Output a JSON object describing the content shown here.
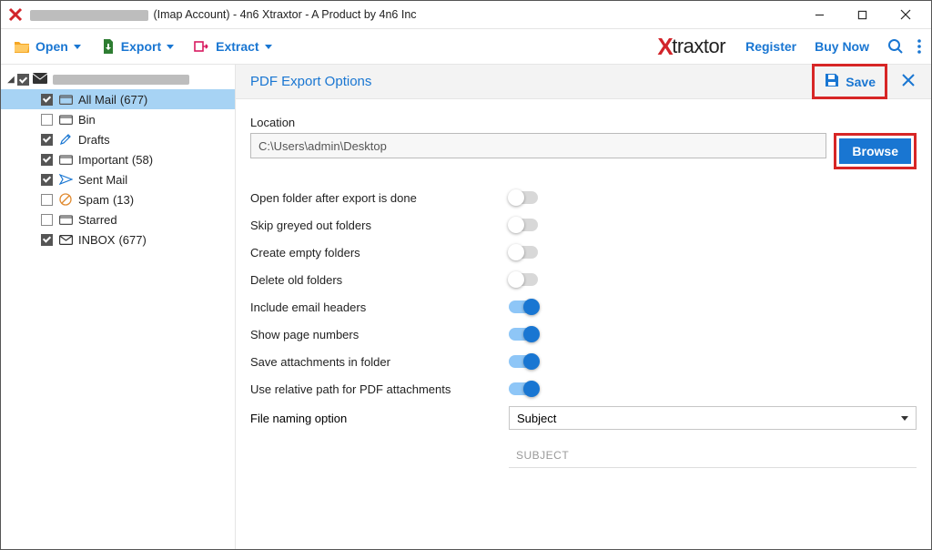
{
  "titlebar": {
    "suffix": "(Imap Account) - 4n6 Xtraxtor - A Product by 4n6 Inc"
  },
  "toolbar": {
    "open": "Open",
    "export": "Export",
    "extract": "Extract",
    "brand_rest": "traxtor",
    "register": "Register",
    "buy_now": "Buy Now"
  },
  "sidebar": {
    "items": [
      {
        "label": "All Mail",
        "count": "(677)",
        "checked": true,
        "icon": "folder",
        "selected": true
      },
      {
        "label": "Bin",
        "count": "",
        "checked": false,
        "icon": "folder"
      },
      {
        "label": "Drafts",
        "count": "",
        "checked": true,
        "icon": "draft"
      },
      {
        "label": "Important",
        "count": "(58)",
        "checked": true,
        "icon": "folder"
      },
      {
        "label": "Sent Mail",
        "count": "",
        "checked": true,
        "icon": "sent"
      },
      {
        "label": "Spam",
        "count": "(13)",
        "checked": false,
        "icon": "spam"
      },
      {
        "label": "Starred",
        "count": "",
        "checked": false,
        "icon": "folder"
      },
      {
        "label": "INBOX",
        "count": "(677)",
        "checked": true,
        "icon": "inbox"
      }
    ]
  },
  "panel": {
    "title": "PDF Export Options",
    "save": "Save",
    "location_label": "Location",
    "location_value": "C:\\Users\\admin\\Desktop",
    "browse": "Browse",
    "options": [
      {
        "label": "Open folder after export is done",
        "on": false
      },
      {
        "label": "Skip greyed out folders",
        "on": false
      },
      {
        "label": "Create empty folders",
        "on": false
      },
      {
        "label": "Delete old folders",
        "on": false
      },
      {
        "label": "Include email headers",
        "on": true
      },
      {
        "label": "Show page numbers",
        "on": true
      },
      {
        "label": "Save attachments in folder",
        "on": true
      },
      {
        "label": "Use relative path for PDF attachments",
        "on": true
      }
    ],
    "naming_label": "File naming option",
    "naming_value": "Subject",
    "naming_sample": "SUBJECT"
  }
}
